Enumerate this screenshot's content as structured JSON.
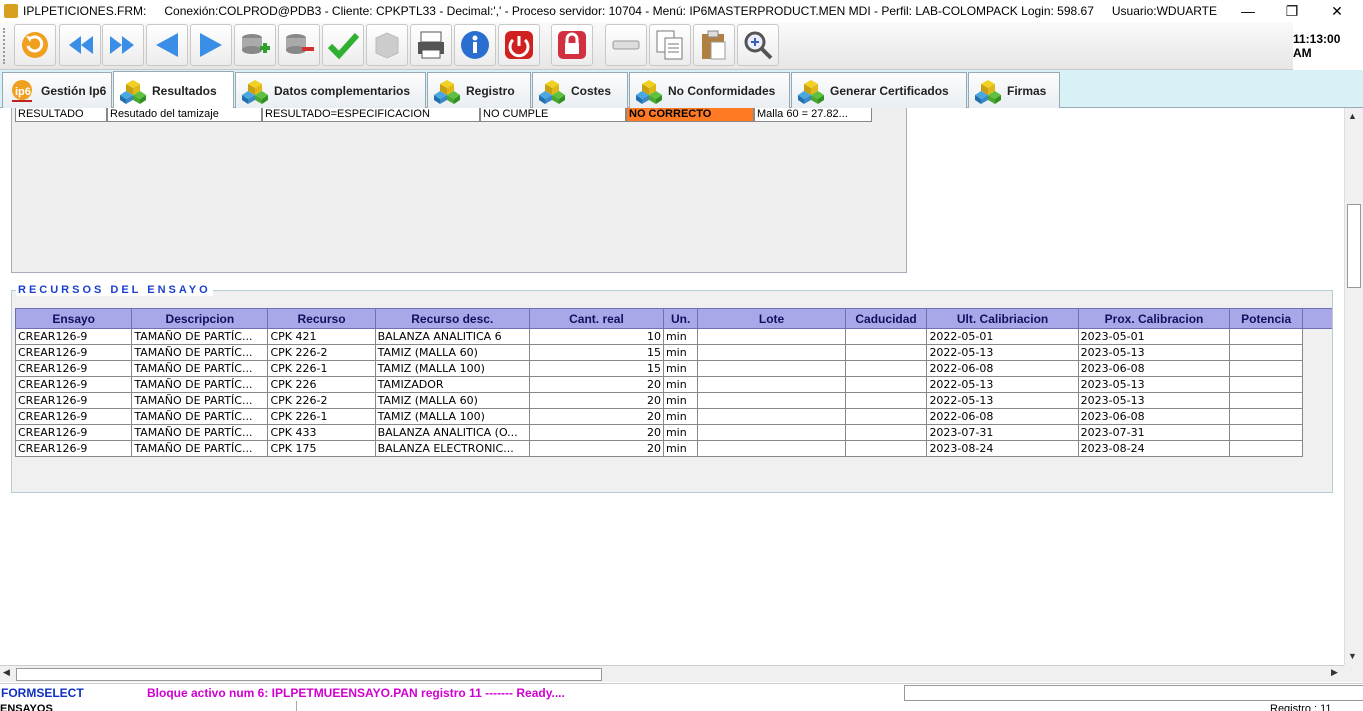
{
  "titlebar": {
    "app": "IPLPETICIONES.FRM:",
    "connection": "Conexión:COLPROD@PDB3 - Cliente: CPKPTL33 - Decimal:',' - Proceso servidor: 10704 - Menú: IP6MASTERPRODUCT.MEN MDI - Perfil: LAB-COLOMPACK Login: 598.67",
    "user": "Usuario:WDUARTE",
    "minimize": "—",
    "restore": "❐",
    "close": "✕"
  },
  "toolbar": {
    "clock": "11:13:00 AM",
    "buttons": [
      {
        "name": "refresh-icon",
        "color": "#f0a020"
      },
      {
        "name": "first-record-icon",
        "color": "#3a8ee6"
      },
      {
        "name": "last-record-icon",
        "color": "#3a8ee6"
      },
      {
        "name": "previous-icon",
        "color": "#3a8ee6"
      },
      {
        "name": "next-icon",
        "color": "#3a8ee6"
      },
      {
        "name": "add-record-icon",
        "color": "#30a030"
      },
      {
        "name": "delete-record-icon",
        "color": "#d03030"
      },
      {
        "name": "accept-icon",
        "color": "#30b030"
      },
      {
        "name": "box-icon",
        "color": "#cccccc"
      },
      {
        "name": "print-icon",
        "color": "#555555"
      },
      {
        "name": "info-icon",
        "color": "#2a6fd0"
      },
      {
        "name": "exit-icon",
        "color": "#d02020"
      },
      {
        "name": "lock-icon",
        "color": "#d03040"
      },
      {
        "name": "eraser-icon",
        "color": "#999999"
      },
      {
        "name": "copy-icon",
        "color": "#777777"
      },
      {
        "name": "paste-icon",
        "color": "#b08040"
      },
      {
        "name": "search-icon",
        "color": "#3060c0"
      }
    ]
  },
  "tabs": [
    {
      "label": "Gestión Ip6",
      "icon": "ip6-logo-icon",
      "active": false
    },
    {
      "label": "Resultados",
      "icon": "cubes-icon",
      "active": true
    },
    {
      "label": "Datos complementarios",
      "icon": "cubes-icon",
      "active": false
    },
    {
      "label": "Registro",
      "icon": "cubes-icon",
      "active": false
    },
    {
      "label": "Costes",
      "icon": "cubes-icon",
      "active": false
    },
    {
      "label": "No Conformidades",
      "icon": "cubes-icon",
      "active": false
    },
    {
      "label": "Generar Certificados",
      "icon": "cubes-icon",
      "active": false
    },
    {
      "label": "Firmas",
      "icon": "cubes-icon",
      "active": false
    }
  ],
  "resultado_row": {
    "cells": [
      "RESULTADO",
      "Resutado del tamizaje",
      "RESULTADO=ESPECIFICACION",
      "NO CUMPLE",
      "NO CORRECTO",
      "Malla 60 = 27.82..."
    ],
    "highlight_color": "#ff7a22"
  },
  "recursos": {
    "title": "RECURSOS DEL ENSAYO",
    "columns": [
      "Ensayo",
      "Descripcion",
      "Recurso",
      "Recurso desc.",
      "Cant. real",
      "Un.",
      "Lote",
      "Caducidad",
      "Ult. Calibriacion",
      "Prox. Calibracion",
      "Potencia"
    ],
    "rows": [
      [
        "CREAR126-9",
        "TAMAÑO DE PARTÍC...",
        "CPK 421",
        "BALANZA ANALITICA 6",
        "10",
        "min",
        "",
        "",
        "2022-05-01",
        "2023-05-01",
        ""
      ],
      [
        "CREAR126-9",
        "TAMAÑO DE PARTÍC...",
        "CPK 226-2",
        "TAMIZ (MALLA 60)",
        "15",
        "min",
        "",
        "",
        "2022-05-13",
        "2023-05-13",
        ""
      ],
      [
        "CREAR126-9",
        "TAMAÑO DE PARTÍC...",
        "CPK 226-1",
        "TAMIZ (MALLA 100)",
        "15",
        "min",
        "",
        "",
        "2022-06-08",
        "2023-06-08",
        ""
      ],
      [
        "CREAR126-9",
        "TAMAÑO DE PARTÍC...",
        "CPK 226",
        "TAMIZADOR",
        "20",
        "min",
        "",
        "",
        "2022-05-13",
        "2023-05-13",
        ""
      ],
      [
        "CREAR126-9",
        "TAMAÑO DE PARTÍC...",
        "CPK 226-2",
        "TAMIZ (MALLA 60)",
        "20",
        "min",
        "",
        "",
        "2022-05-13",
        "2023-05-13",
        ""
      ],
      [
        "CREAR126-9",
        "TAMAÑO DE PARTÍC...",
        "CPK 226-1",
        "TAMIZ (MALLA 100)",
        "20",
        "min",
        "",
        "",
        "2022-06-08",
        "2023-06-08",
        ""
      ],
      [
        "CREAR126-9",
        "TAMAÑO DE PARTÍC...",
        "CPK 433",
        "BALANZA ANALITICA (O...",
        "20",
        "min",
        "",
        "",
        "2023-07-31",
        "2023-07-31",
        ""
      ],
      [
        "CREAR126-9",
        "TAMAÑO DE PARTÍC...",
        "CPK 175",
        "BALANZA ELECTRONIC...",
        "20",
        "min",
        "",
        "",
        "2023-08-24",
        "2023-08-24",
        ""
      ]
    ]
  },
  "statusbar": {
    "form": "FORMSELECT",
    "message": "Bloque activo num 6: IPLPETMUEENSAYO.PAN  registro 11 ------- Ready....",
    "block": "ENSAYOS",
    "right": "Registro : 11"
  }
}
